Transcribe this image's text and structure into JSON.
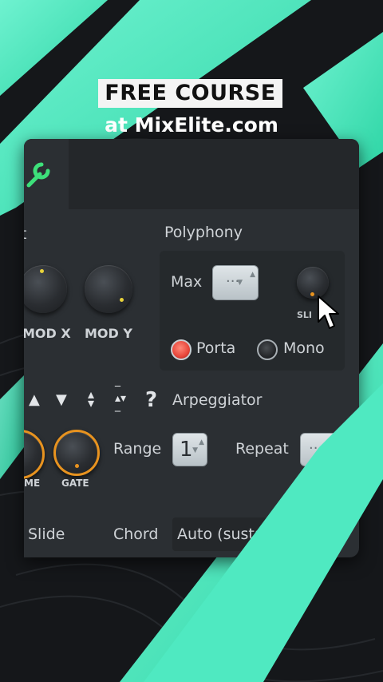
{
  "banner": {
    "title": "FREE COURSE",
    "subtitle": "at MixElite.com"
  },
  "panel": {
    "section_left_fragment": "t",
    "mod_x_label": "MOD X",
    "mod_y_label": "MOD Y",
    "polyphony": {
      "title": "Polyphony",
      "max_label": "Max",
      "max_value": "···",
      "slide_label": "SLI",
      "porta_label": "Porta",
      "mono_label": "Mono",
      "porta_active": true
    },
    "arp": {
      "icons": [
        "triangle-up-icon",
        "triangle-down-icon",
        "up-down-icon",
        "expand-icon"
      ],
      "help": "?",
      "title": "Arpeggiator",
      "time_label": "ME",
      "gate_label": "GATE",
      "range_label": "Range",
      "range_value": "1",
      "repeat_label": "Repeat",
      "repeat_value": "···",
      "slide_label": "Slide",
      "chord_label": "Chord",
      "chord_value": "Auto (sustai"
    }
  },
  "colors": {
    "accent_green": "#3de07a",
    "gate_orange": "#e8931f",
    "porta_red": "#e8463a",
    "teal": "#4fe9c1"
  }
}
